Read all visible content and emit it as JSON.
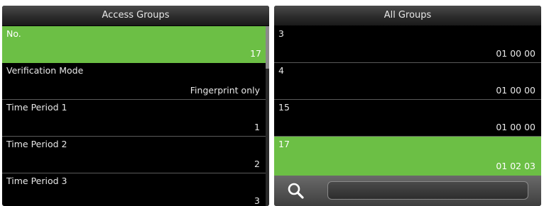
{
  "access_groups": {
    "title": "Access Groups",
    "rows": [
      {
        "label": "No.",
        "value": "17"
      },
      {
        "label": "Verification Mode",
        "value": "Fingerprint only"
      },
      {
        "label": "Time Period 1",
        "value": "1"
      },
      {
        "label": "Time Period 2",
        "value": "2"
      },
      {
        "label": "Time Period 3",
        "value": "3"
      }
    ]
  },
  "all_groups": {
    "title": "All Groups",
    "rows": [
      {
        "label": "3",
        "value": "01 00 00"
      },
      {
        "label": "4",
        "value": "01 00 00"
      },
      {
        "label": "15",
        "value": "01 00 00"
      },
      {
        "label": "17",
        "value": "01 02 03"
      }
    ],
    "search_icon": "search-icon"
  },
  "colors": {
    "selected_row": "#6cbf45",
    "background": "#000000"
  }
}
